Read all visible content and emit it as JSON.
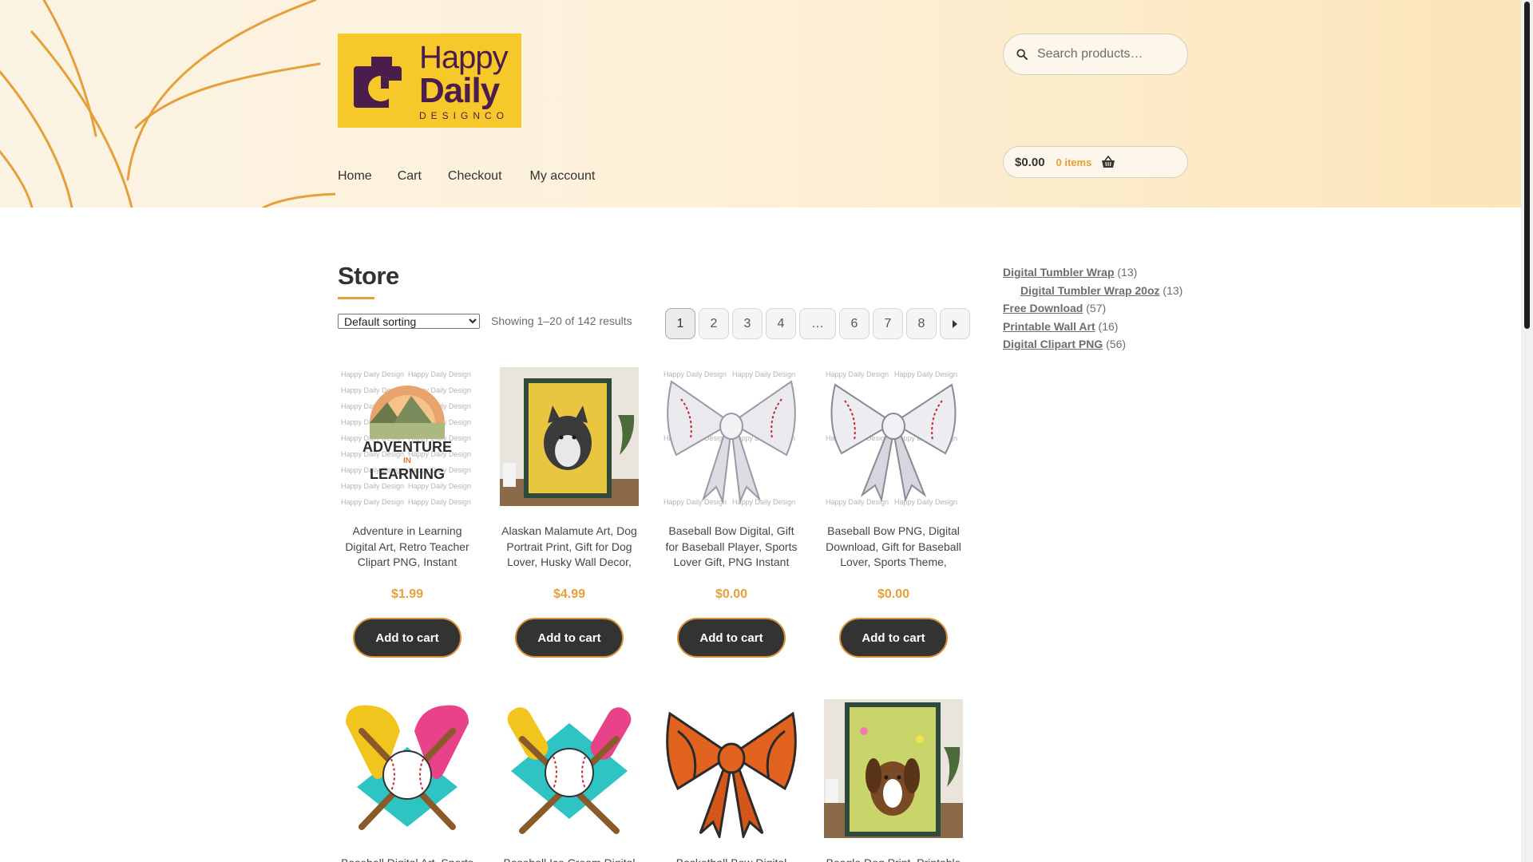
{
  "site": {
    "logo": {
      "line1": "Happy",
      "line2": "Daily",
      "line3": "DESIGNCO"
    },
    "nav": [
      "Home",
      "Cart",
      "Checkout",
      "My account"
    ],
    "search": {
      "placeholder": "Search products…"
    },
    "cart": {
      "amount": "$0.00",
      "count": "0 items"
    }
  },
  "page": {
    "title": "Store",
    "sort": {
      "selected": "Default sorting"
    },
    "result_count": "Showing 1–20 of 142 results",
    "pagination": [
      "1",
      "2",
      "3",
      "4",
      "…",
      "6",
      "7",
      "8"
    ],
    "current_page": "1"
  },
  "sidebar": {
    "categories": [
      {
        "name": "Digital Tumbler Wrap",
        "count": "(13)",
        "child": false
      },
      {
        "name": "Digital Tumbler Wrap 20oz",
        "count": "(13)",
        "child": true
      },
      {
        "name": "Free Download",
        "count": "(57)",
        "child": false
      },
      {
        "name": "Printable Wall Art",
        "count": "(16)",
        "child": false
      },
      {
        "name": "Digital Clipart PNG",
        "count": "(56)",
        "child": false
      }
    ]
  },
  "products": [
    {
      "title": "Adventure in Learning Digital Art, Retro Teacher Clipart PNG, Instant",
      "price": "$1.99",
      "button": "Add to cart",
      "art": "adventure",
      "art_text": [
        "ADVENTURE",
        "IN",
        "LEARNING"
      ]
    },
    {
      "title": "Alaskan Malamute Art, Dog Portrait Print, Gift for Dog Lover, Husky Wall Decor,",
      "price": "$4.99",
      "button": "Add to cart",
      "art": "dog-husky"
    },
    {
      "title": "Baseball Bow Digital, Gift for Baseball Player, Sports Lover Gift, PNG Instant",
      "price": "$0.00",
      "button": "Add to cart",
      "art": "bow-baseball"
    },
    {
      "title": "Baseball Bow PNG, Digital Download, Gift for Baseball Lover, Sports Theme,",
      "price": "$0.00",
      "button": "Add to cart",
      "art": "bow-baseball-2"
    },
    {
      "title": "Baseball Digital Art, Sports",
      "price": "",
      "button": "",
      "art": "baseball-icecream"
    },
    {
      "title": "Baseball Ice Cream Digital",
      "price": "",
      "button": "",
      "art": "baseball-icecream-2"
    },
    {
      "title": "Basketball Bow Digital",
      "price": "",
      "button": "",
      "art": "bow-basketball"
    },
    {
      "title": "Beagle Dog Print, Printable",
      "price": "",
      "button": "",
      "art": "dog-beagle"
    }
  ],
  "watermark": "Happy Daily Design",
  "colors": {
    "accent": "#e5a03b",
    "button_bg": "#333333",
    "logo_bg": "#f7c82a",
    "logo_text": "#4a1d4d"
  }
}
